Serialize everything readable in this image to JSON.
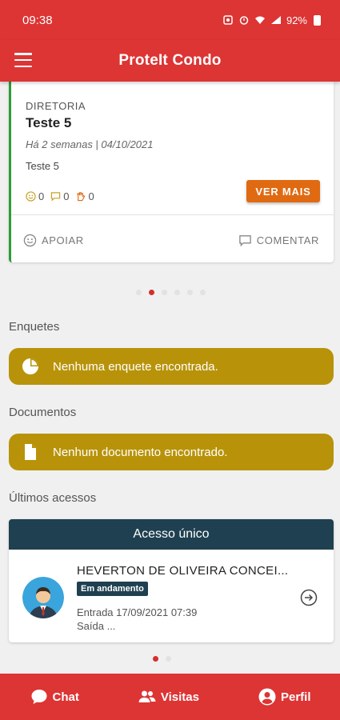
{
  "status_bar": {
    "time": "09:38",
    "battery": "92%"
  },
  "app_bar": {
    "title": "ProteIt Condo"
  },
  "notice": {
    "category": "DIRETORIA",
    "title": "Teste 5",
    "date": "Há 2 semanas | 04/10/2021",
    "body": "Teste 5",
    "reactions": {
      "likes": "0",
      "comments": "0",
      "views": "0"
    },
    "ver_mais_label": "VER MAIS",
    "apoiar_label": "APOIAR",
    "comentar_label": "COMENTAR"
  },
  "pager_top": {
    "count": 6,
    "active": 1
  },
  "enquetes": {
    "label": "Enquetes",
    "empty_text": "Nenhuma enquete encontrada."
  },
  "documentos": {
    "label": "Documentos",
    "empty_text": "Nenhum documento encontrado."
  },
  "acessos": {
    "label": "Últimos acessos",
    "card_title": "Acesso único",
    "name": "HEVERTON DE OLIVEIRA CONCEI...",
    "status": "Em andamento",
    "entrada": "Entrada 17/09/2021 07:39",
    "saida": "Saída ..."
  },
  "pager_bottom": {
    "count": 2,
    "active": 0
  },
  "bottom_nav": {
    "chat": "Chat",
    "visitas": "Visitas",
    "perfil": "Perfil"
  },
  "colors": {
    "primary": "#dd3434",
    "success_border": "#2e9b37",
    "warning": "#b8930a",
    "accent": "#e06a12",
    "dark": "#1f4050"
  },
  "icons": [
    "menu-icon",
    "smile-icon",
    "comment-icon",
    "hand-icon",
    "pie-chart-icon",
    "document-icon",
    "arrow-right-circle-icon",
    "chat-icon",
    "people-icon",
    "person-icon"
  ]
}
